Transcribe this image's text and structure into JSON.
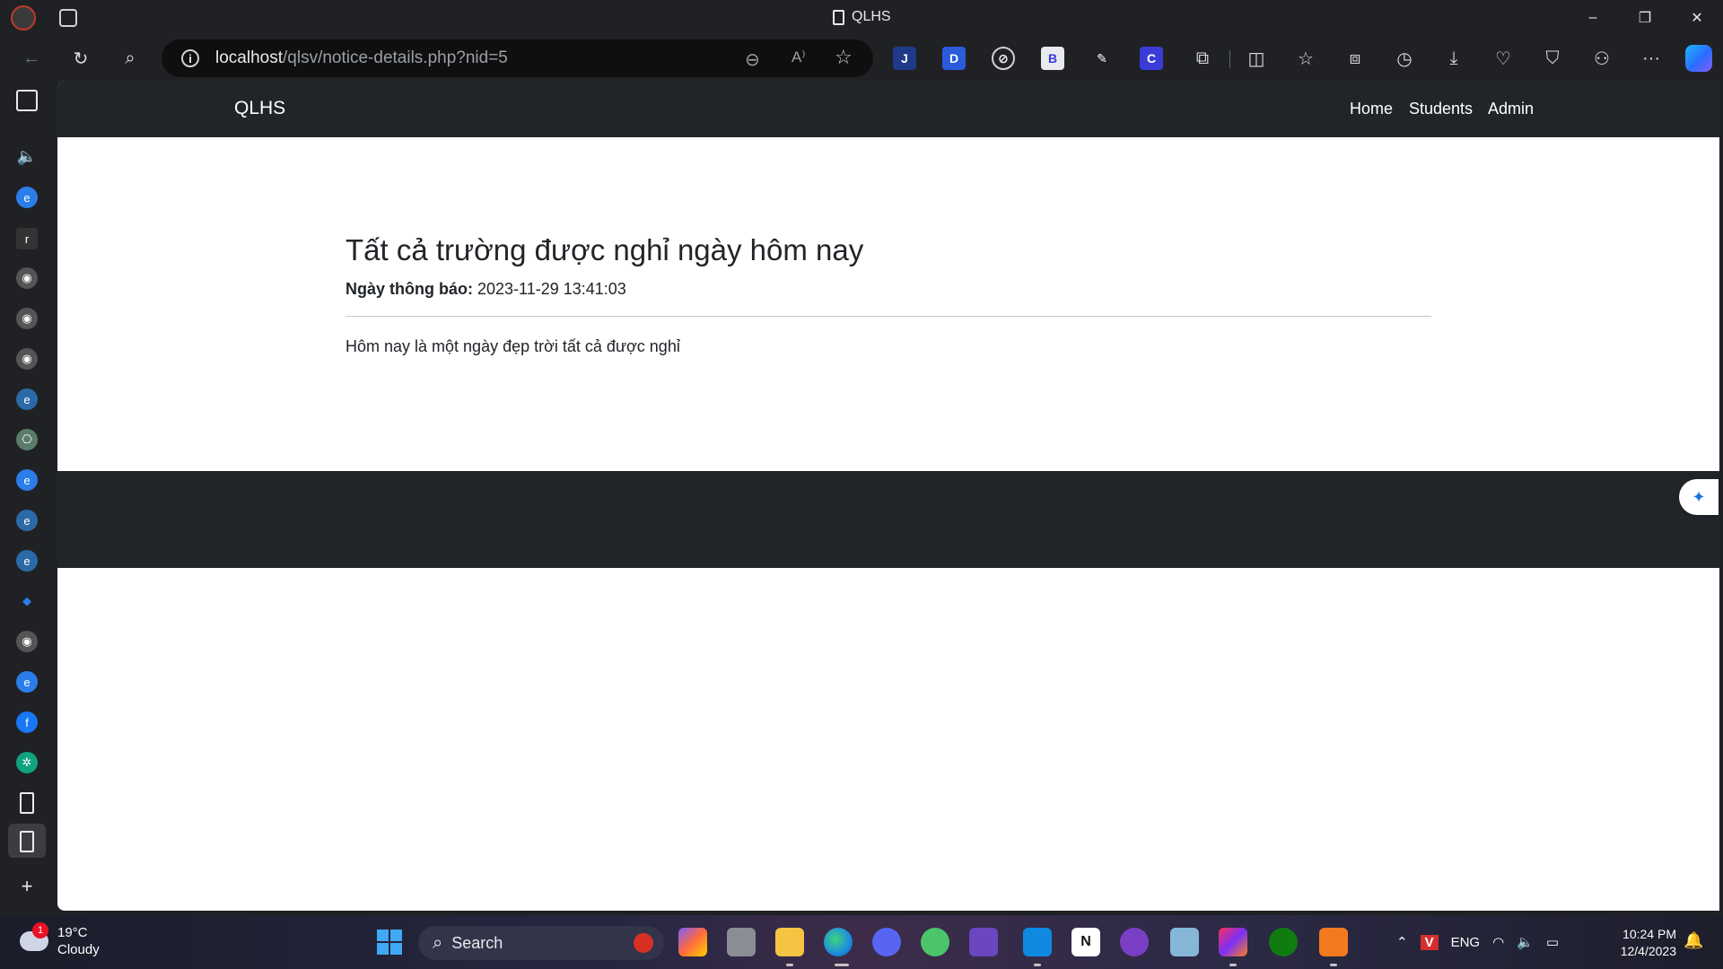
{
  "window": {
    "tab_title": "QLHS",
    "minimize": "–",
    "restore": "❐",
    "close": "✕"
  },
  "toolbar": {
    "url_host": "localhost",
    "url_path": "/qlsv/notice-details.php?nid=5",
    "info_glyph": "i",
    "read_aloud": "A⁾",
    "more": "···"
  },
  "extensions": [
    {
      "name": "j-extension-icon",
      "label": "J",
      "color": "#1e3a8a"
    },
    {
      "name": "d-extension-icon",
      "label": "D",
      "color": "#2b5adb"
    },
    {
      "name": "compass-extension-icon",
      "label": "⊘",
      "color": "#202124"
    },
    {
      "name": "b-extension-icon",
      "label": "B",
      "color": "#e8eaed"
    },
    {
      "name": "eyedropper-extension-icon",
      "label": "✎",
      "color": "#202124"
    },
    {
      "name": "c-extension-icon",
      "label": "C",
      "color": "#3b3bd8"
    }
  ],
  "page": {
    "brand": "QLHS",
    "nav": [
      "Home",
      "Students",
      "Admin"
    ],
    "notice": {
      "title": "Tất cả trường được nghỉ ngày hôm nay",
      "date_label": "Ngày thông báo:",
      "date_value": "2023-11-29 13:41:03",
      "body": "Hôm nay là một ngày đẹp trời tất cả được nghỉ"
    }
  },
  "taskbar": {
    "weather_temp": "19°C",
    "weather_desc": "Cloudy",
    "weather_badge": "1",
    "search_label": "Search",
    "language": "ENG",
    "time": "10:24 PM",
    "date": "12/4/2023"
  },
  "colors": {
    "navbar": "#212529",
    "chrome": "#202124",
    "content_bg": "#ffffff"
  }
}
